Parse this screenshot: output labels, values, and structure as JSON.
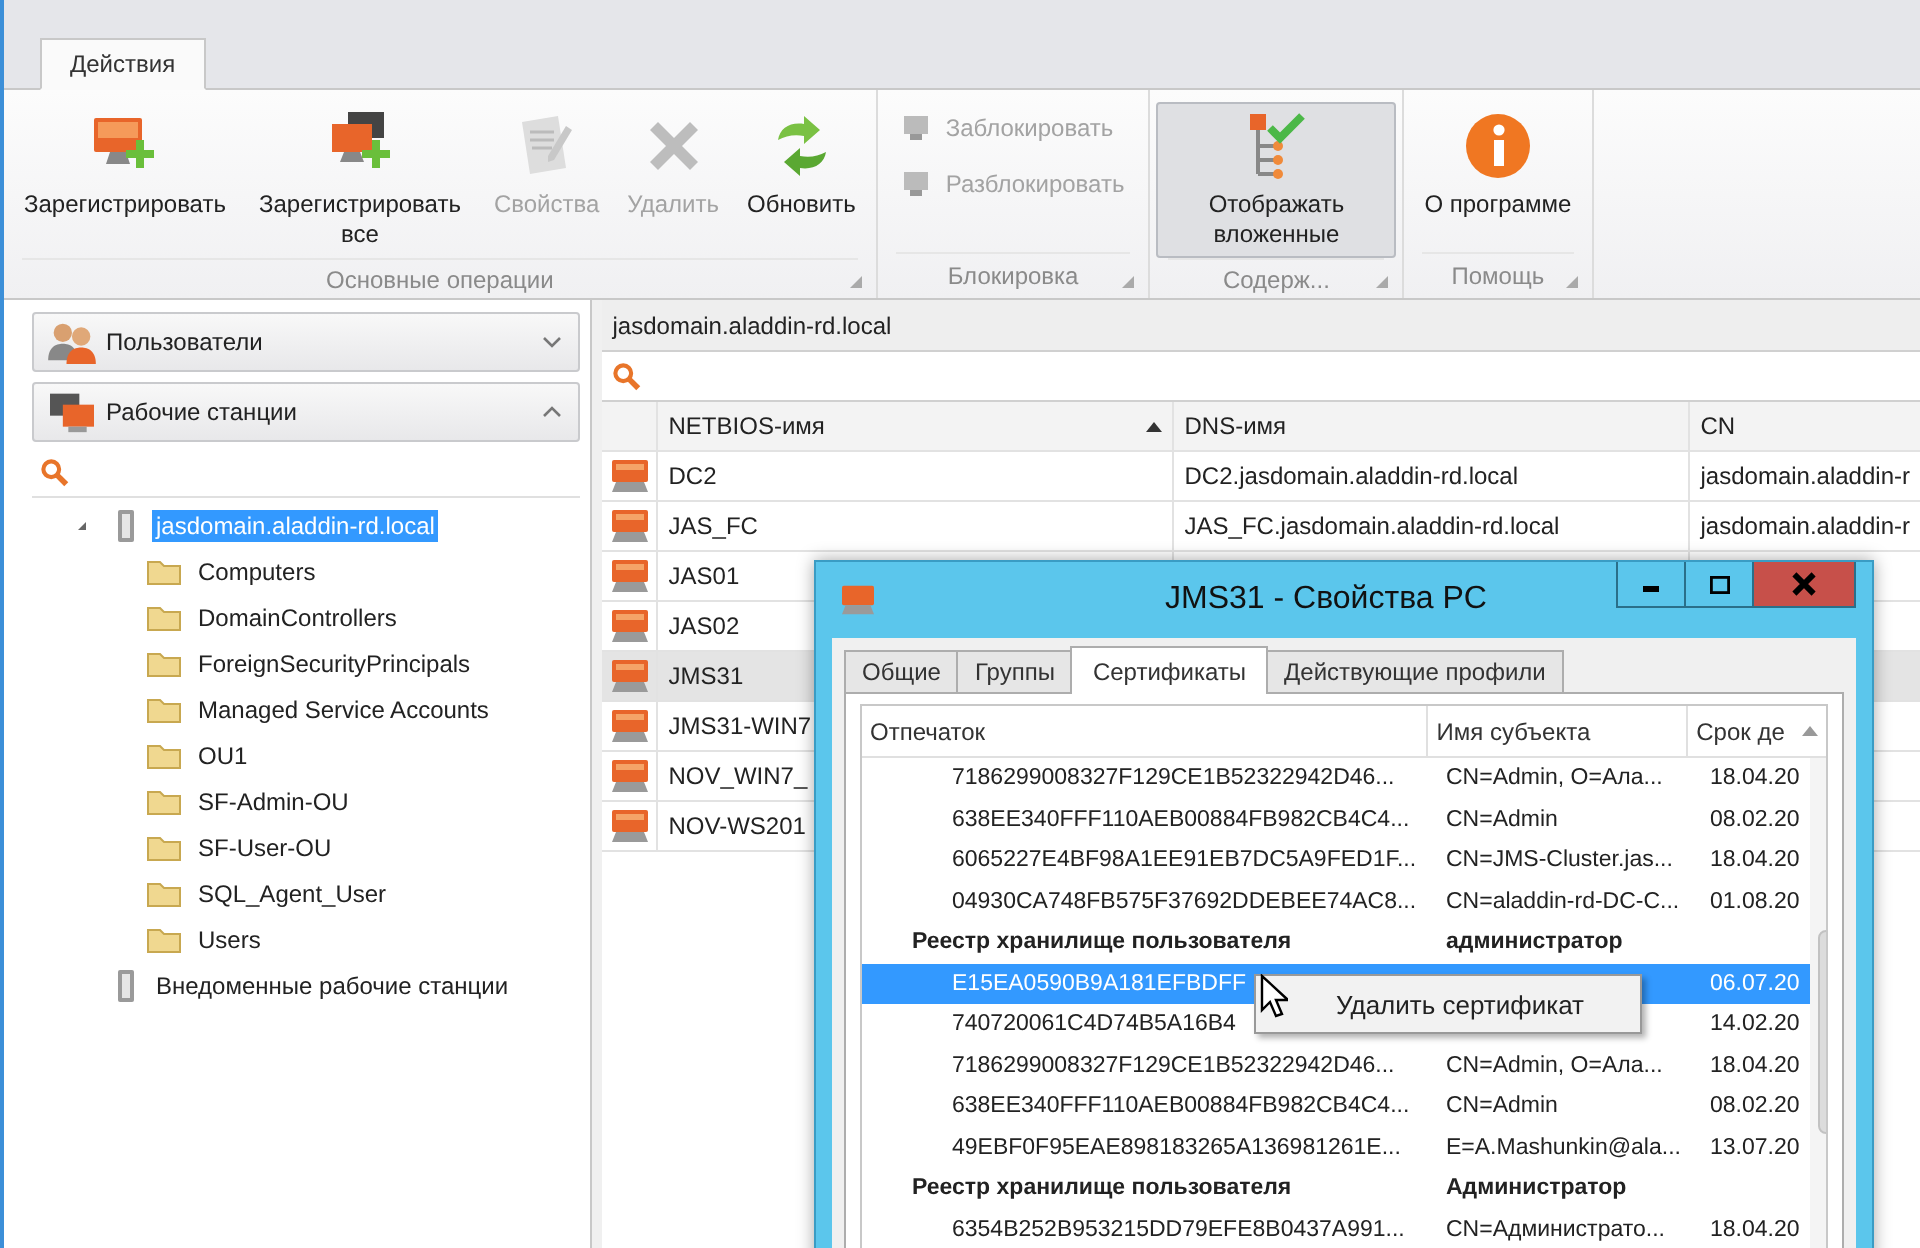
{
  "ribbon": {
    "tabs": [
      {
        "label": "Действия",
        "selected": true
      }
    ],
    "groups": [
      {
        "title": "Основные операции",
        "buttons": [
          {
            "kind": "large",
            "label": "Зарегистрировать",
            "disabled": false,
            "pressed": false
          },
          {
            "kind": "large",
            "label": "Зарегистрировать все",
            "disabled": false,
            "pressed": false
          },
          {
            "kind": "large",
            "label": "Свойства",
            "disabled": true,
            "pressed": false
          },
          {
            "kind": "large",
            "label": "Удалить",
            "disabled": true,
            "pressed": false
          },
          {
            "kind": "large",
            "label": "Обновить",
            "disabled": false,
            "pressed": false
          }
        ]
      },
      {
        "title": "Блокировка",
        "buttons": [
          {
            "kind": "small",
            "label": "Заблокировать",
            "disabled": true,
            "pressed": false
          },
          {
            "kind": "small",
            "label": "Разблокировать",
            "disabled": true,
            "pressed": false
          }
        ]
      },
      {
        "title": "Содерж...",
        "buttons": [
          {
            "kind": "large",
            "label": "Отображать вложенные",
            "disabled": false,
            "pressed": true
          }
        ]
      },
      {
        "title": "Помощь",
        "buttons": [
          {
            "kind": "large",
            "label": "О программе",
            "disabled": false,
            "pressed": false
          }
        ]
      }
    ]
  },
  "sidebar": {
    "sections": [
      {
        "label": "Пользователи",
        "expanded": false
      },
      {
        "label": "Рабочие станции",
        "expanded": true
      }
    ],
    "tree": [
      {
        "label": "jasdomain.aladdin-rd.local",
        "selected": true,
        "expanded": true,
        "children": [
          {
            "label": "Computers",
            "selected": false
          },
          {
            "label": "DomainControllers",
            "selected": false
          },
          {
            "label": "ForeignSecurityPrincipals",
            "selected": false
          },
          {
            "label": "Managed Service Accounts",
            "selected": false
          },
          {
            "label": "OU1",
            "selected": false
          },
          {
            "label": "SF-Admin-OU",
            "selected": false
          },
          {
            "label": "SF-User-OU",
            "selected": false
          },
          {
            "label": "SQL_Agent_User",
            "selected": false
          },
          {
            "label": "Users",
            "selected": false
          }
        ]
      },
      {
        "label": "Внедоменные рабочие станции",
        "selected": false
      }
    ]
  },
  "main": {
    "path": "jasdomain.aladdin-rd.local",
    "table": {
      "columns": [
        {
          "label": "NETBIOS-имя",
          "sorted": true
        },
        {
          "label": "DNS-имя",
          "sorted": false
        },
        {
          "label": "CN",
          "sorted": false
        }
      ],
      "rows": [
        {
          "cells": [
            "DC2",
            "DC2.jasdomain.aladdin-rd.local",
            "jasdomain.aladdin-r"
          ],
          "selected": false
        },
        {
          "cells": [
            "JAS_FC",
            "JAS_FC.jasdomain.aladdin-rd.local",
            "jasdomain.aladdin-r"
          ],
          "selected": false
        },
        {
          "cells": [
            "JAS01"
          ],
          "selected": false
        },
        {
          "cells": [
            "JAS02"
          ],
          "selected": false
        },
        {
          "cells": [
            "JMS31"
          ],
          "selected": true
        },
        {
          "cells": [
            "JMS31-WIN7"
          ],
          "selected": false
        },
        {
          "cells": [
            "NOV_WIN7_"
          ],
          "selected": false
        },
        {
          "cells": [
            "NOV-WS201"
          ],
          "selected": false
        }
      ]
    }
  },
  "dialog": {
    "title": "JMS31 - Свойства PC",
    "tabs": [
      {
        "label": "Общие",
        "selected": false
      },
      {
        "label": "Группы",
        "selected": false
      },
      {
        "label": "Сертификаты",
        "selected": true
      },
      {
        "label": "Действующие профили",
        "selected": false
      }
    ],
    "list": {
      "columns": [
        "Отпечаток",
        "Имя субъекта",
        "Срок де"
      ],
      "rows": [
        {
          "kind": "cert",
          "thumbprint": "7186299008327F129CE1B52322942D46...",
          "subject": "CN=Admin, O=Ала...",
          "date": "18.04.20",
          "selected": false
        },
        {
          "kind": "cert",
          "thumbprint": "638EE340FFF110AEB00884FB982CB4C4...",
          "subject": "CN=Admin",
          "date": "08.02.20",
          "selected": false
        },
        {
          "kind": "cert",
          "thumbprint": "6065227E4BF98A1EE91EB7DC5A9FED1F...",
          "subject": "CN=JMS-Cluster.jas...",
          "date": "18.04.20",
          "selected": false
        },
        {
          "kind": "cert",
          "thumbprint": "04930CA748FB575F37692DDEBEE74AC8...",
          "subject": "CN=aladdin-rd-DC-C...",
          "date": "01.08.20",
          "selected": false
        },
        {
          "kind": "group",
          "store": "Реестр хранилище пользователя",
          "user": "администратор"
        },
        {
          "kind": "cert",
          "thumbprint": "E15EA0590B9A181EFBDFF",
          "date": "06.07.20",
          "selected": true
        },
        {
          "kind": "cert",
          "thumbprint": "740720061C4D74B5A16B4",
          "date": "14.02.20",
          "selected": false
        },
        {
          "kind": "cert",
          "thumbprint": "7186299008327F129CE1B52322942D46...",
          "subject": "CN=Admin, O=Ала...",
          "date": "18.04.20",
          "selected": false
        },
        {
          "kind": "cert",
          "thumbprint": "638EE340FFF110AEB00884FB982CB4C4...",
          "subject": "CN=Admin",
          "date": "08.02.20",
          "selected": false
        },
        {
          "kind": "cert",
          "thumbprint": "49EBF0F95EAE898183265A136981261E...",
          "subject": "E=A.Mashunkin@ala...",
          "date": "13.07.20",
          "selected": false
        },
        {
          "kind": "group",
          "store": "Реестр хранилище пользователя",
          "user": "Администратор"
        },
        {
          "kind": "cert",
          "thumbprint": "6354B252B953215DD79EFE8B0437A991...",
          "subject": "CN=Администрато...",
          "date": "18.04.20",
          "selected": false
        }
      ]
    },
    "context_menu": {
      "items": [
        "Удалить сертификат"
      ]
    }
  }
}
